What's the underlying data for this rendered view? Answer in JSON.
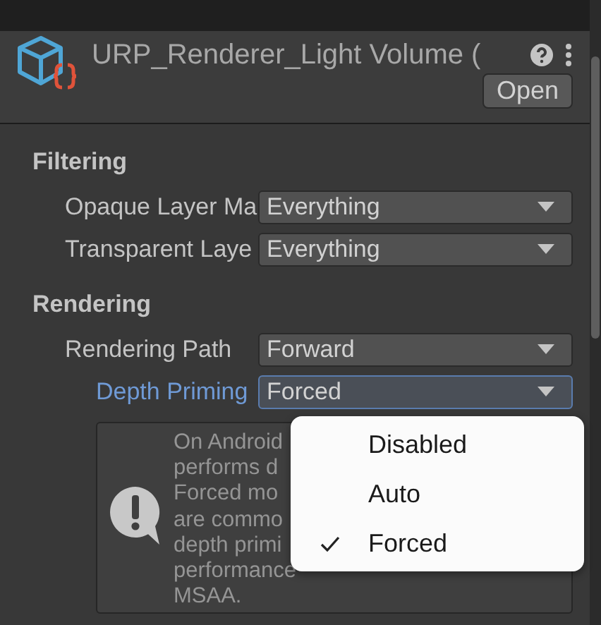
{
  "header": {
    "title": "URP_Renderer_Light Volume (",
    "open_button": "Open"
  },
  "sections": [
    {
      "title": "Filtering",
      "fields": [
        {
          "label": "Opaque Layer Ma",
          "value": "Everything",
          "focused": false,
          "indent": false
        },
        {
          "label": "Transparent Laye",
          "value": "Everything",
          "focused": false,
          "indent": false
        }
      ]
    },
    {
      "title": "Rendering",
      "fields": [
        {
          "label": "Rendering Path",
          "value": "Forward",
          "focused": false,
          "indent": false
        },
        {
          "label": "Depth Priming",
          "value": "Forced",
          "focused": true,
          "indent": true
        }
      ]
    }
  ],
  "help_box": {
    "lines": [
      "On Android",
      "performs d",
      "Forced mo",
      "are commo",
      "depth primi",
      "performance",
      "MSAA."
    ]
  },
  "dropdown_menu": {
    "items": [
      {
        "label": "Disabled",
        "selected": false
      },
      {
        "label": "Auto",
        "selected": false
      },
      {
        "label": "Forced",
        "selected": true
      }
    ]
  }
}
